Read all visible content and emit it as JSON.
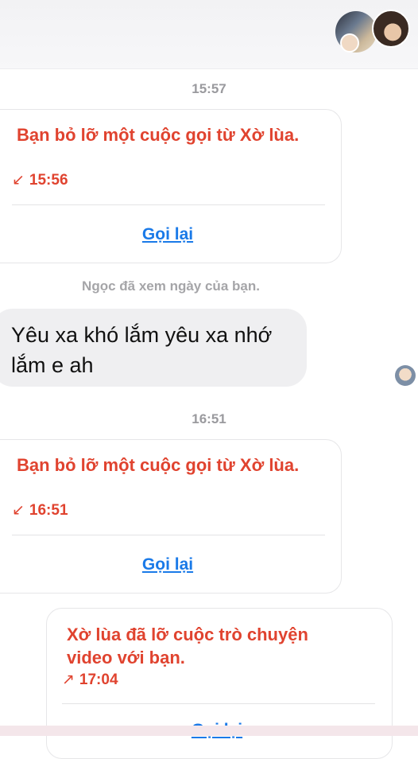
{
  "conversation": {
    "times": [
      "15:57",
      "16:51"
    ],
    "seen_text": "Ngọc đã xem ngày của bạn.",
    "calls": [
      {
        "title": "Bạn bỏ lỡ một cuộc gọi từ Xờ lùa.",
        "time": "15:56",
        "arrow": "↙",
        "action": "Gọi lại"
      },
      {
        "title": "Bạn bỏ lỡ một cuộc gọi từ Xờ lùa.",
        "time": "16:51",
        "arrow": "↙",
        "action": "Gọi lại"
      },
      {
        "title": "Xờ lùa đã lỡ cuộc trò chuyện video với bạn.",
        "time": "17:04",
        "arrow": "↗",
        "action": "Gọi lại"
      }
    ],
    "message": "Yêu xa khó lắm yêu xa nhớ lắm e ah"
  },
  "colors": {
    "missed_call": "#e0432f",
    "link": "#1a7ae8",
    "bubble": "#efeff1"
  }
}
